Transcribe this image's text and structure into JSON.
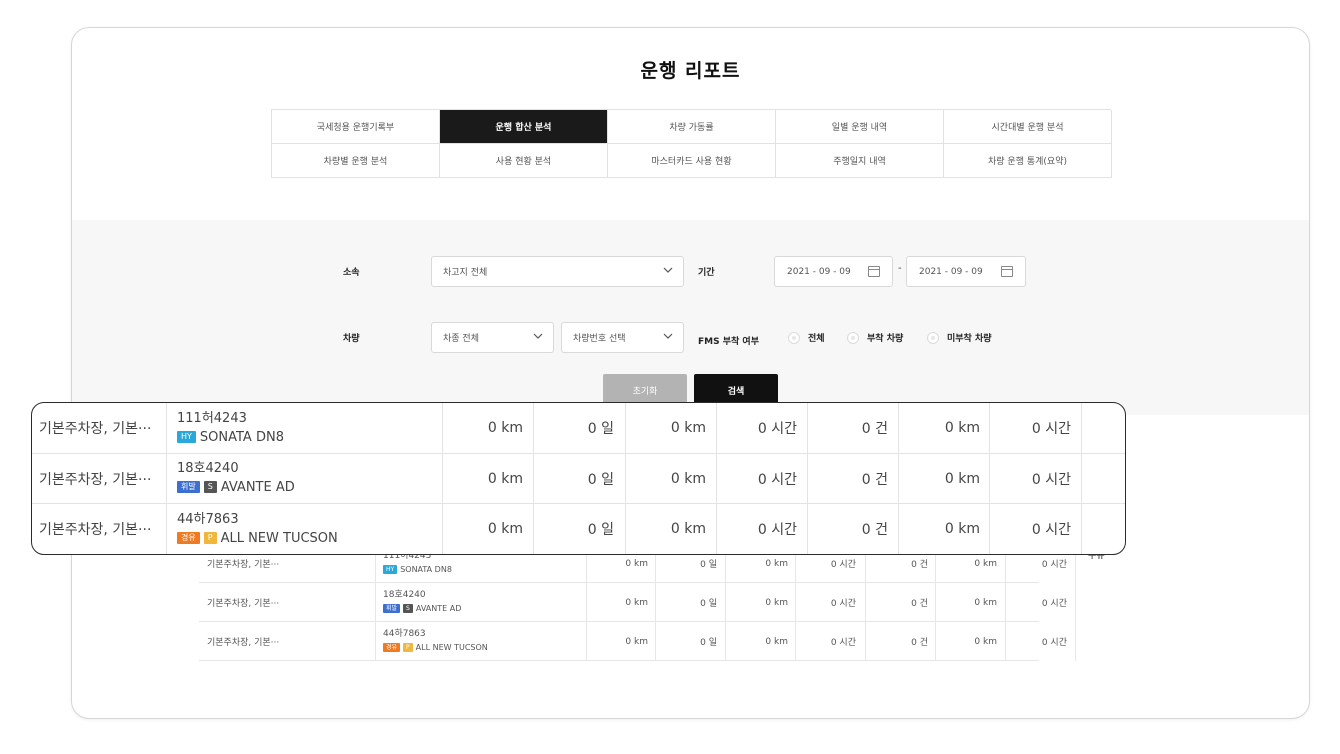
{
  "page": {
    "title": "운행 리포트"
  },
  "tabs": [
    {
      "label": "국세청용 운행기록부",
      "active": false
    },
    {
      "label": "운행 합산 분석",
      "active": true
    },
    {
      "label": "차량 가동률",
      "active": false
    },
    {
      "label": "일별 운행 내역",
      "active": false
    },
    {
      "label": "시간대별 운행 분석",
      "active": false
    },
    {
      "label": "차량별 운행 분석",
      "active": false
    },
    {
      "label": "사용 현황 분석",
      "active": false
    },
    {
      "label": "마스터카드 사용 현황",
      "active": false
    },
    {
      "label": "주행일지 내역",
      "active": false
    },
    {
      "label": "차량 운행 통계(요약)",
      "active": false
    }
  ],
  "filters": {
    "affiliation_label": "소속",
    "affiliation_value": "차고지 전체",
    "period_label": "기간",
    "date_from": "2021 - 09 - 09",
    "date_to": "2021 - 09 - 09",
    "date_separator": "-",
    "vehicle_label": "차량",
    "vehicle_type_value": "차종 전체",
    "vehicle_number_placeholder": "차량번호 선택",
    "fms_label": "FMS 부착 여부",
    "fms_options": [
      {
        "label": "전체"
      },
      {
        "label": "부착 차량"
      },
      {
        "label": "미부착 차량"
      }
    ],
    "reset_label": "초기화",
    "search_label": "검색"
  },
  "table": {
    "header_fragment": "주유",
    "rows": [
      {
        "location": "기본주차장, 기본···",
        "plate": "111허4243",
        "badges": [
          {
            "text": "HY",
            "color": "#29a8d9"
          }
        ],
        "model": "SONATA DN8",
        "values": [
          "0 km",
          "0 일",
          "0 km",
          "0 시간",
          "0 건",
          "0 km",
          "0 시간"
        ]
      },
      {
        "location": "기본주차장, 기본···",
        "plate": "18호4240",
        "badges": [
          {
            "text": "휘발",
            "color": "#3d6fcf"
          },
          {
            "text": "S",
            "color": "#555555"
          }
        ],
        "model": "AVANTE AD",
        "values": [
          "0 km",
          "0 일",
          "0 km",
          "0 시간",
          "0 건",
          "0 km",
          "0 시간"
        ]
      },
      {
        "location": "기본주차장, 기본···",
        "plate": "44하7863",
        "badges": [
          {
            "text": "경유",
            "color": "#f07a22"
          },
          {
            "text": "P",
            "color": "#f2b63a"
          }
        ],
        "model": "ALL NEW TUCSON",
        "values": [
          "0 km",
          "0 일",
          "0 km",
          "0 시간",
          "0 건",
          "0 km",
          "0 시간"
        ]
      }
    ]
  },
  "icons": {
    "chevron": "chevron-down-icon",
    "calendar": "calendar-icon",
    "radio": "radio-icon"
  }
}
